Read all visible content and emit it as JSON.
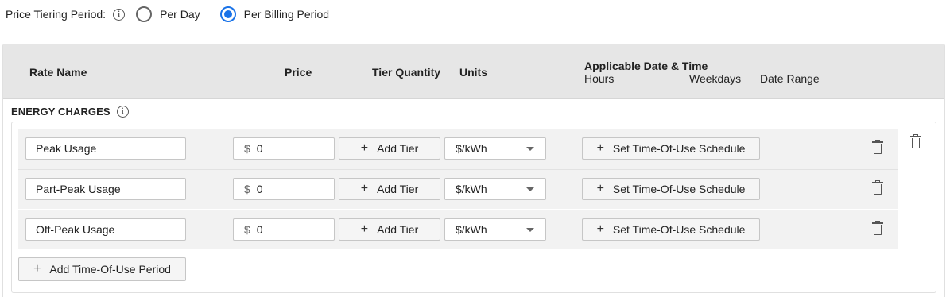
{
  "tiering": {
    "label": "Price Tiering Period:",
    "options": [
      {
        "label": "Per Day",
        "selected": false
      },
      {
        "label": "Per Billing Period",
        "selected": true
      }
    ]
  },
  "header": {
    "rate_name": "Rate Name",
    "price": "Price",
    "tier_quantity": "Tier Quantity",
    "units": "Units",
    "applicable": "Applicable Date & Time",
    "hours": "Hours",
    "weekdays": "Weekdays",
    "date_range": "Date Range"
  },
  "section": {
    "title": "ENERGY CHARGES",
    "add_period_label": "Add Time-Of-Use Period"
  },
  "rows": [
    {
      "name": "Peak Usage",
      "currency": "$",
      "price": "0",
      "add_tier_label": "Add Tier",
      "units": "$/kWh",
      "schedule_label": "Set Time-Of-Use Schedule"
    },
    {
      "name": "Part-Peak Usage",
      "currency": "$",
      "price": "0",
      "add_tier_label": "Add Tier",
      "units": "$/kWh",
      "schedule_label": "Set Time-Of-Use Schedule"
    },
    {
      "name": "Off-Peak Usage",
      "currency": "$",
      "price": "0",
      "add_tier_label": "Add Tier",
      "units": "$/kWh",
      "schedule_label": "Set Time-Of-Use Schedule"
    }
  ],
  "icons": {
    "info": "info-icon",
    "delete": "trash-icon",
    "plus": "plus-icon",
    "dropdown": "caret-down-icon"
  },
  "colors": {
    "accent": "#1a73e8",
    "header_bg": "#e6e6e6",
    "row_bg": "#f2f2f2"
  }
}
